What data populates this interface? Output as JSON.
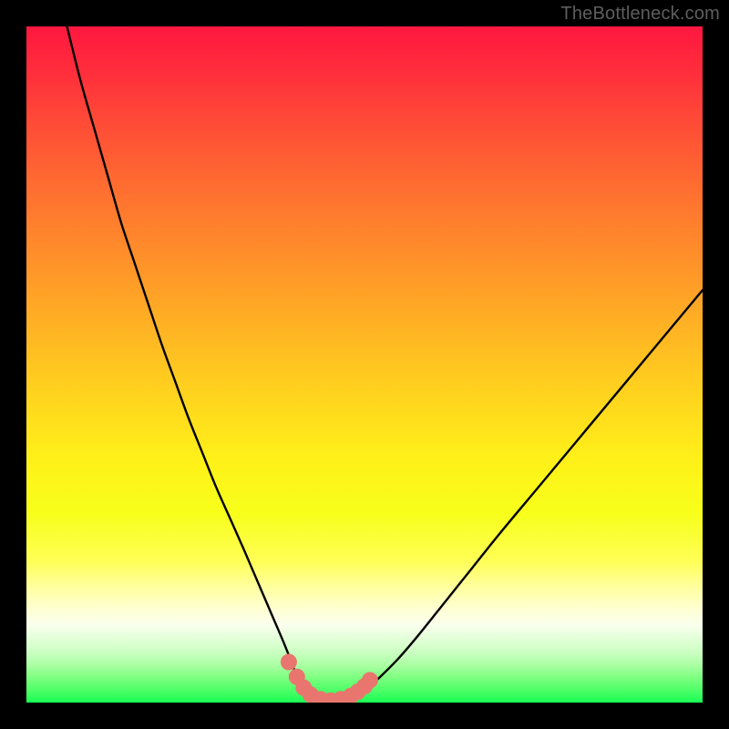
{
  "watermark": {
    "text": "TheBottleneck.com"
  },
  "colors": {
    "curve_stroke": "#000000",
    "marker_fill": "#e9766e",
    "marker_stroke": "#e9766e",
    "frame_bg": "#000000"
  },
  "chart_data": {
    "type": "line",
    "title": "",
    "xlabel": "",
    "ylabel": "",
    "xlim": [
      0,
      100
    ],
    "ylim": [
      0,
      100
    ],
    "grid": false,
    "series": [
      {
        "name": "bottleneck-curve",
        "x": [
          6,
          8,
          10,
          12,
          14,
          16,
          18,
          20,
          22,
          24,
          26,
          28,
          30,
          32,
          33.5,
          35,
          36.5,
          38,
          39,
          40,
          41.5,
          43,
          45,
          47,
          48.5,
          50,
          52,
          55,
          58,
          62,
          66,
          70,
          75,
          80,
          85,
          90,
          95,
          100
        ],
        "y": [
          100,
          92,
          85,
          78,
          71,
          65,
          59,
          53,
          47.5,
          42,
          37,
          32,
          27.5,
          23,
          19.5,
          16,
          12.5,
          9,
          6.5,
          4,
          2,
          0.8,
          0.4,
          0.4,
          0.8,
          1.7,
          3.5,
          6.5,
          10,
          15,
          20,
          25,
          31,
          37,
          43,
          49,
          55,
          61
        ]
      }
    ],
    "markers": {
      "name": "highlight-points",
      "x": [
        38.8,
        40,
        41,
        42,
        43.5,
        45,
        46.5,
        48,
        49,
        50,
        50.8
      ],
      "y": [
        6.0,
        3.8,
        2.2,
        1.2,
        0.5,
        0.3,
        0.5,
        1.0,
        1.6,
        2.4,
        3.3
      ]
    }
  }
}
